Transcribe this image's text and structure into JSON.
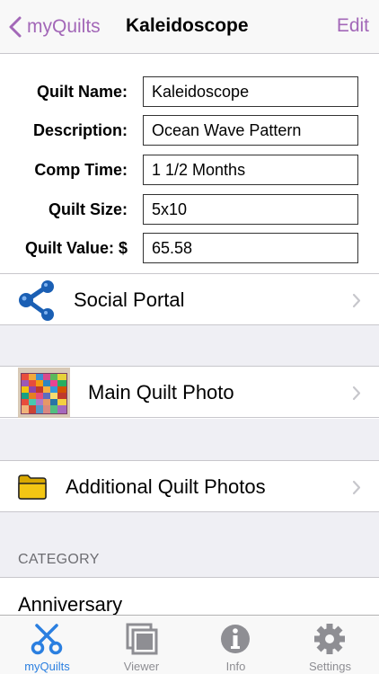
{
  "navbar": {
    "back_label": "myQuilts",
    "title": "Kaleidoscope",
    "edit_label": "Edit"
  },
  "form": {
    "fields": [
      {
        "label": "Quilt Name:",
        "value": "Kaleidoscope"
      },
      {
        "label": "Description:",
        "value": "Ocean Wave Pattern"
      },
      {
        "label": "Comp Time:",
        "value": "1 1/2 Months"
      },
      {
        "label": "Quilt Size:",
        "value": "5x10"
      },
      {
        "label": "Quilt Value: $",
        "value": "65.58"
      }
    ]
  },
  "cells": {
    "social": "Social Portal",
    "main_photo": "Main Quilt Photo",
    "additional_photos": "Additional Quilt Photos"
  },
  "category": {
    "header": "CATEGORY",
    "value": "Anniversary"
  },
  "tabs": [
    {
      "label": "myQuilts",
      "icon": "scissors-icon",
      "active": true
    },
    {
      "label": "Viewer",
      "icon": "viewer-icon",
      "active": false
    },
    {
      "label": "Info",
      "icon": "info-icon",
      "active": false
    },
    {
      "label": "Settings",
      "icon": "gear-icon",
      "active": false
    }
  ],
  "colors": {
    "accent": "#a368b8",
    "tab_active": "#2b7fe0",
    "tab_inactive": "#8e8e93",
    "group_bg": "#efeff4",
    "share_blue": "#1a5fb4",
    "folder_yellow": "#f3c614"
  }
}
